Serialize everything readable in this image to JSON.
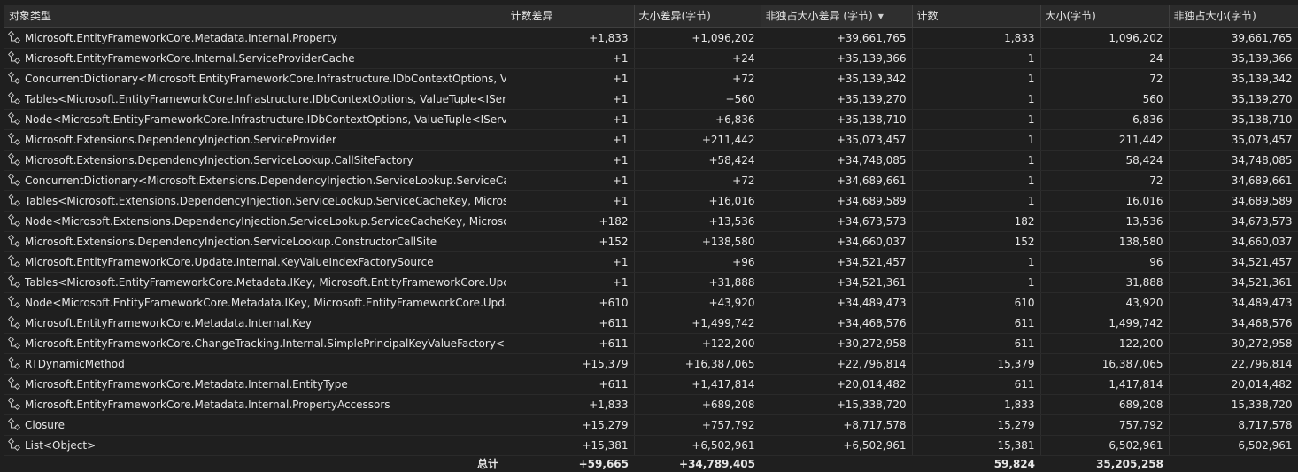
{
  "columns": [
    {
      "label": "对象类型"
    },
    {
      "label": "计数差异"
    },
    {
      "label": "大小差异(字节)"
    },
    {
      "label": "非独占大小差异 (字节)"
    },
    {
      "label": "计数"
    },
    {
      "label": "大小(字节)"
    },
    {
      "label": "非独占大小(字节)"
    }
  ],
  "sorted_column": "非独占大小差异 (字节)",
  "sort_direction": "descending",
  "rows": [
    {
      "name": "Microsoft.EntityFrameworkCore.Metadata.Internal.Property",
      "count_diff": "+1,833",
      "size_diff": "+1,096,202",
      "incl_size_diff": "+39,661,765",
      "count": "1,833",
      "size": "1,096,202",
      "incl_size": "39,661,765"
    },
    {
      "name": "Microsoft.EntityFrameworkCore.Internal.ServiceProviderCache",
      "count_diff": "+1",
      "size_diff": "+24",
      "incl_size_diff": "+35,139,366",
      "count": "1",
      "size": "24",
      "incl_size": "35,139,366"
    },
    {
      "name": "ConcurrentDictionary<Microsoft.EntityFrameworkCore.Infrastructure.IDbContextOptions, Valu",
      "count_diff": "+1",
      "size_diff": "+72",
      "incl_size_diff": "+35,139,342",
      "count": "1",
      "size": "72",
      "incl_size": "35,139,342"
    },
    {
      "name": "Tables<Microsoft.EntityFrameworkCore.Infrastructure.IDbContextOptions, ValueTuple<IServi",
      "count_diff": "+1",
      "size_diff": "+560",
      "incl_size_diff": "+35,139,270",
      "count": "1",
      "size": "560",
      "incl_size": "35,139,270"
    },
    {
      "name": "Node<Microsoft.EntityFrameworkCore.Infrastructure.IDbContextOptions, ValueTuple<IServic",
      "count_diff": "+1",
      "size_diff": "+6,836",
      "incl_size_diff": "+35,138,710",
      "count": "1",
      "size": "6,836",
      "incl_size": "35,138,710"
    },
    {
      "name": "Microsoft.Extensions.DependencyInjection.ServiceProvider",
      "count_diff": "+1",
      "size_diff": "+211,442",
      "incl_size_diff": "+35,073,457",
      "count": "1",
      "size": "211,442",
      "incl_size": "35,073,457"
    },
    {
      "name": "Microsoft.Extensions.DependencyInjection.ServiceLookup.CallSiteFactory",
      "count_diff": "+1",
      "size_diff": "+58,424",
      "incl_size_diff": "+34,748,085",
      "count": "1",
      "size": "58,424",
      "incl_size": "34,748,085"
    },
    {
      "name": "ConcurrentDictionary<Microsoft.Extensions.DependencyInjection.ServiceLookup.ServiceCach",
      "count_diff": "+1",
      "size_diff": "+72",
      "incl_size_diff": "+34,689,661",
      "count": "1",
      "size": "72",
      "incl_size": "34,689,661"
    },
    {
      "name": "Tables<Microsoft.Extensions.DependencyInjection.ServiceLookup.ServiceCacheKey, Microsof",
      "count_diff": "+1",
      "size_diff": "+16,016",
      "incl_size_diff": "+34,689,589",
      "count": "1",
      "size": "16,016",
      "incl_size": "34,689,589"
    },
    {
      "name": "Node<Microsoft.Extensions.DependencyInjection.ServiceLookup.ServiceCacheKey, Microsoft",
      "count_diff": "+182",
      "size_diff": "+13,536",
      "incl_size_diff": "+34,673,573",
      "count": "182",
      "size": "13,536",
      "incl_size": "34,673,573"
    },
    {
      "name": "Microsoft.Extensions.DependencyInjection.ServiceLookup.ConstructorCallSite",
      "count_diff": "+152",
      "size_diff": "+138,580",
      "incl_size_diff": "+34,660,037",
      "count": "152",
      "size": "138,580",
      "incl_size": "34,660,037"
    },
    {
      "name": "Microsoft.EntityFrameworkCore.Update.Internal.KeyValueIndexFactorySource",
      "count_diff": "+1",
      "size_diff": "+96",
      "incl_size_diff": "+34,521,457",
      "count": "1",
      "size": "96",
      "incl_size": "34,521,457"
    },
    {
      "name": "Tables<Microsoft.EntityFrameworkCore.Metadata.IKey, Microsoft.EntityFrameworkCore.Upd",
      "count_diff": "+1",
      "size_diff": "+31,888",
      "incl_size_diff": "+34,521,361",
      "count": "1",
      "size": "31,888",
      "incl_size": "34,521,361"
    },
    {
      "name": "Node<Microsoft.EntityFrameworkCore.Metadata.IKey, Microsoft.EntityFrameworkCore.Upda",
      "count_diff": "+610",
      "size_diff": "+43,920",
      "incl_size_diff": "+34,489,473",
      "count": "610",
      "size": "43,920",
      "incl_size": "34,489,473"
    },
    {
      "name": "Microsoft.EntityFrameworkCore.Metadata.Internal.Key",
      "count_diff": "+611",
      "size_diff": "+1,499,742",
      "incl_size_diff": "+34,468,576",
      "count": "611",
      "size": "1,499,742",
      "incl_size": "34,468,576"
    },
    {
      "name": "Microsoft.EntityFrameworkCore.ChangeTracking.Internal.SimplePrincipalKeyValueFactory<Int",
      "count_diff": "+611",
      "size_diff": "+122,200",
      "incl_size_diff": "+30,272,958",
      "count": "611",
      "size": "122,200",
      "incl_size": "30,272,958"
    },
    {
      "name": "RTDynamicMethod",
      "count_diff": "+15,379",
      "size_diff": "+16,387,065",
      "incl_size_diff": "+22,796,814",
      "count": "15,379",
      "size": "16,387,065",
      "incl_size": "22,796,814"
    },
    {
      "name": "Microsoft.EntityFrameworkCore.Metadata.Internal.EntityType",
      "count_diff": "+611",
      "size_diff": "+1,417,814",
      "incl_size_diff": "+20,014,482",
      "count": "611",
      "size": "1,417,814",
      "incl_size": "20,014,482"
    },
    {
      "name": "Microsoft.EntityFrameworkCore.Metadata.Internal.PropertyAccessors",
      "count_diff": "+1,833",
      "size_diff": "+689,208",
      "incl_size_diff": "+15,338,720",
      "count": "1,833",
      "size": "689,208",
      "incl_size": "15,338,720"
    },
    {
      "name": "Closure",
      "count_diff": "+15,279",
      "size_diff": "+757,792",
      "incl_size_diff": "+8,717,578",
      "count": "15,279",
      "size": "757,792",
      "incl_size": "8,717,578"
    },
    {
      "name": "List<Object>",
      "count_diff": "+15,381",
      "size_diff": "+6,502,961",
      "incl_size_diff": "+6,502,961",
      "count": "15,381",
      "size": "6,502,961",
      "incl_size": "6,502,961"
    }
  ],
  "totals": {
    "label": "总计",
    "count_diff": "+59,665",
    "size_diff": "+34,789,405",
    "count": "59,824",
    "size": "35,205,258"
  },
  "icon": "class-type-icon",
  "colors": {
    "background": "#1f1f1f",
    "header": "#2b2b2b",
    "text": "#e6e6e6",
    "icon_stroke": "#c8c8c8"
  }
}
